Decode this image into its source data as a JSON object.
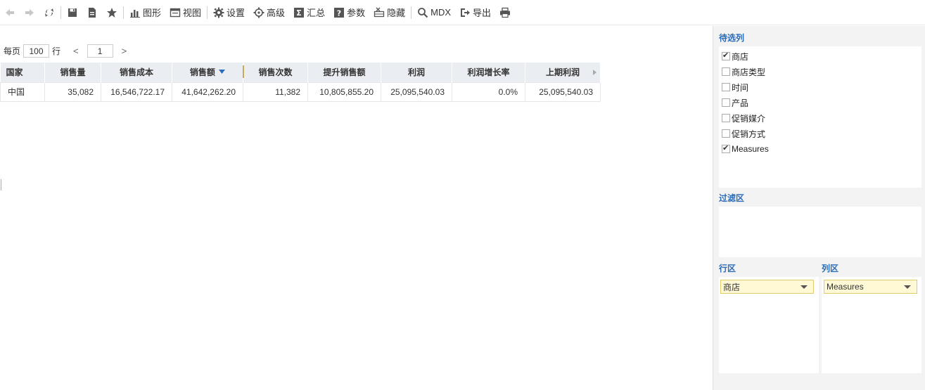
{
  "toolbar": {
    "chart_label": "图形",
    "view_label": "视图",
    "settings_label": "设置",
    "advanced_label": "高级",
    "summary_label": "汇总",
    "params_label": "参数",
    "hide_label": "隐藏",
    "mdx_label": "MDX",
    "export_label": "导出"
  },
  "pager": {
    "per_page_label": "每页",
    "page_size": "100",
    "rows_label": "行",
    "prev": "<",
    "page": "1",
    "next": ">"
  },
  "table": {
    "headers": [
      "国家",
      "销售量",
      "销售成本",
      "销售额",
      "销售次数",
      "提升销售额",
      "利润",
      "利润增长率",
      "上期利润"
    ],
    "rows": [
      [
        "中国",
        "35,082",
        "16,546,722.17",
        "41,642,262.20",
        "11,382",
        "10,805,855.20",
        "25,095,540.03",
        "0.0%",
        "25,095,540.03"
      ]
    ]
  },
  "panel": {
    "available_title": "待选列",
    "fields": [
      {
        "label": "商店",
        "checked": true
      },
      {
        "label": "商店类型",
        "checked": false
      },
      {
        "label": "时间",
        "checked": false
      },
      {
        "label": "产品",
        "checked": false
      },
      {
        "label": "促销媒介",
        "checked": false
      },
      {
        "label": "促销方式",
        "checked": false
      },
      {
        "label": "Measures",
        "checked": true
      }
    ],
    "filter_title": "过滤区",
    "row_title": "行区",
    "col_title": "列区",
    "row_item": "商店",
    "col_item": "Measures"
  },
  "colors": {
    "accent": "#2b6cb8",
    "header_bg": "#eaedf1",
    "chip_bg": "#fff9d6",
    "chip_border": "#e3cb69"
  }
}
